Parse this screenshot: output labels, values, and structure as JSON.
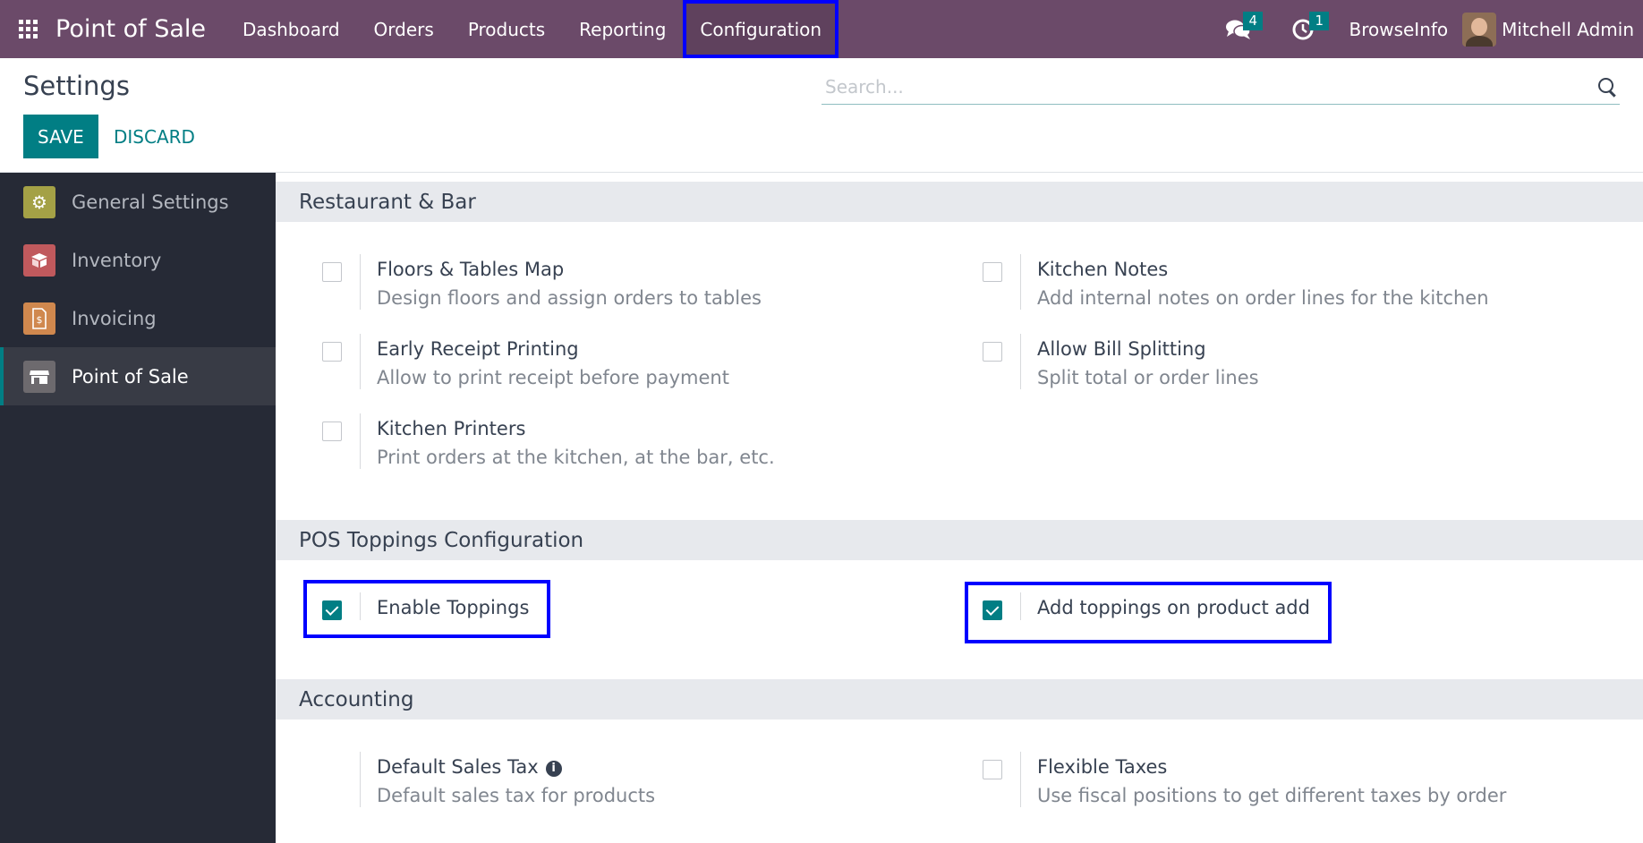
{
  "navbar": {
    "brand": "Point of Sale",
    "menu": [
      {
        "label": "Dashboard"
      },
      {
        "label": "Orders"
      },
      {
        "label": "Products"
      },
      {
        "label": "Reporting"
      },
      {
        "label": "Configuration",
        "highlighted": true
      }
    ],
    "messages_count": "4",
    "activities_count": "1",
    "company": "BrowseInfo",
    "user": "Mitchell Admin"
  },
  "control": {
    "title": "Settings",
    "search_placeholder": "Search...",
    "save_label": "SAVE",
    "discard_label": "DISCARD"
  },
  "sidebar": {
    "items": [
      {
        "label": "General Settings",
        "icon": "gear-icon",
        "color": "#a4a146",
        "active": false
      },
      {
        "label": "Inventory",
        "icon": "box-icon",
        "color": "#c0595d",
        "active": false
      },
      {
        "label": "Invoicing",
        "icon": "invoice-icon",
        "color": "#d0884e",
        "active": false
      },
      {
        "label": "Point of Sale",
        "icon": "shop-icon",
        "color": "#6d6a6e",
        "active": true
      }
    ]
  },
  "sections": {
    "restaurant": {
      "title": "Restaurant & Bar",
      "settings": [
        {
          "title": "Floors & Tables Map",
          "desc": "Design floors and assign orders to tables",
          "checked": false
        },
        {
          "title": "Kitchen Notes",
          "desc": "Add internal notes on order lines for the kitchen",
          "checked": false
        },
        {
          "title": "Early Receipt Printing",
          "desc": "Allow to print receipt before payment",
          "checked": false
        },
        {
          "title": "Allow Bill Splitting",
          "desc": "Split total or order lines",
          "checked": false
        },
        {
          "title": "Kitchen Printers",
          "desc": "Print orders at the kitchen, at the bar, etc.",
          "checked": false
        }
      ]
    },
    "toppings": {
      "title": "POS Toppings Configuration",
      "settings": [
        {
          "title": "Enable Toppings",
          "checked": true
        },
        {
          "title": "Add toppings on product add",
          "checked": true
        }
      ]
    },
    "accounting": {
      "title": "Accounting",
      "settings": [
        {
          "title": "Default Sales Tax",
          "desc": "Default sales tax for products"
        },
        {
          "title": "Flexible Taxes",
          "desc": "Use fiscal positions to get different taxes by order",
          "checked": false
        }
      ]
    }
  },
  "colors": {
    "navbar": "#6b4a69",
    "accent": "#017e84",
    "sidebar": "#262a36",
    "highlight": "#0000ff"
  }
}
